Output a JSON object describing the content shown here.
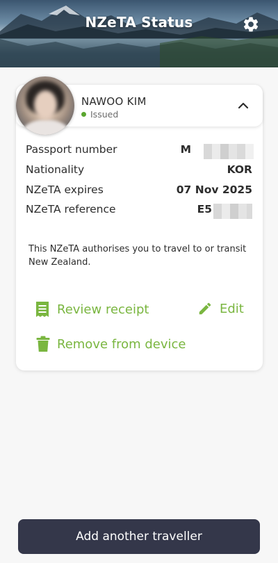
{
  "header": {
    "title": "NZeTA Status",
    "settings_icon": "gear-icon"
  },
  "traveller": {
    "name": "NAWOO KIM",
    "status": "Issued",
    "status_color": "#5aa62f",
    "collapse_icon": "chevron-up-icon"
  },
  "details": [
    {
      "label": "Passport number",
      "value": "M"
    },
    {
      "label": "Nationality",
      "value": "KOR"
    },
    {
      "label": "NZeTA expires",
      "value": "07 Nov 2025"
    },
    {
      "label": "NZeTA reference",
      "value": "E5"
    }
  ],
  "info_text": "This NZeTA authorises you to travel to or transit New Zealand.",
  "actions": {
    "review_receipt": "Review receipt",
    "edit": "Edit",
    "remove": "Remove from device"
  },
  "footer": {
    "add_button": "Add another traveller"
  },
  "colors": {
    "accent": "#7ab640",
    "button_bg": "#34374a"
  }
}
